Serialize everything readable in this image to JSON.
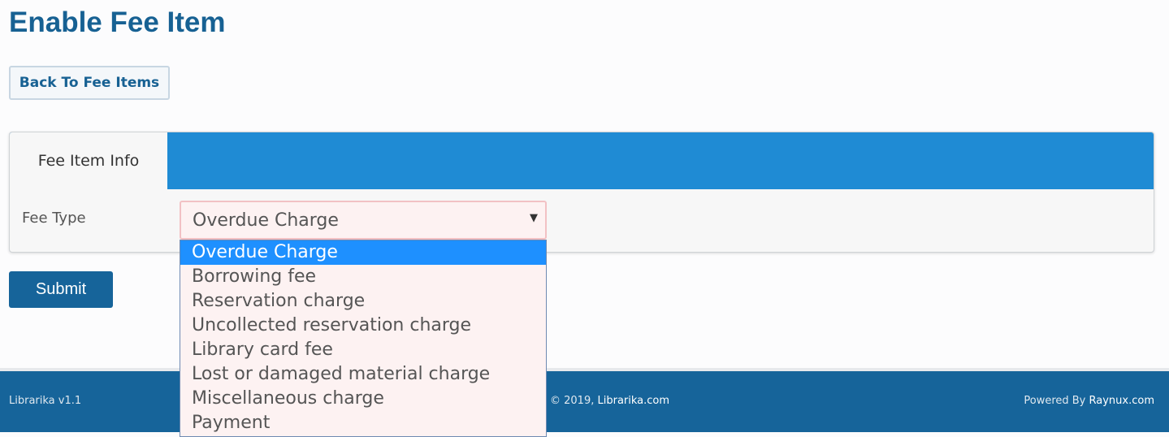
{
  "page": {
    "title": "Enable Fee Item"
  },
  "toolbar": {
    "back_label": "Back To Fee Items"
  },
  "panel": {
    "tab_label": "Fee Item Info",
    "fee_type_label": "Fee Type",
    "fee_type_value": "Overdue Charge",
    "fee_type_options": [
      "Overdue Charge",
      "Borrowing fee",
      "Reservation charge",
      "Uncollected reservation charge",
      "Library card fee",
      "Lost or damaged material charge",
      "Miscellaneous charge",
      "Payment"
    ]
  },
  "form": {
    "submit_label": "Submit"
  },
  "footer": {
    "version": "Librarika v1.1",
    "copyright_prefix": "© 2019,",
    "copyright_link": "Librarika.com",
    "powered_prefix": "Powered By",
    "powered_link": "Raynux.com"
  },
  "colors": {
    "brand_blue": "#176193",
    "tab_bar_blue": "#1f8bd4",
    "selected_option": "#1e90ff",
    "footer_bg": "#16649a"
  }
}
